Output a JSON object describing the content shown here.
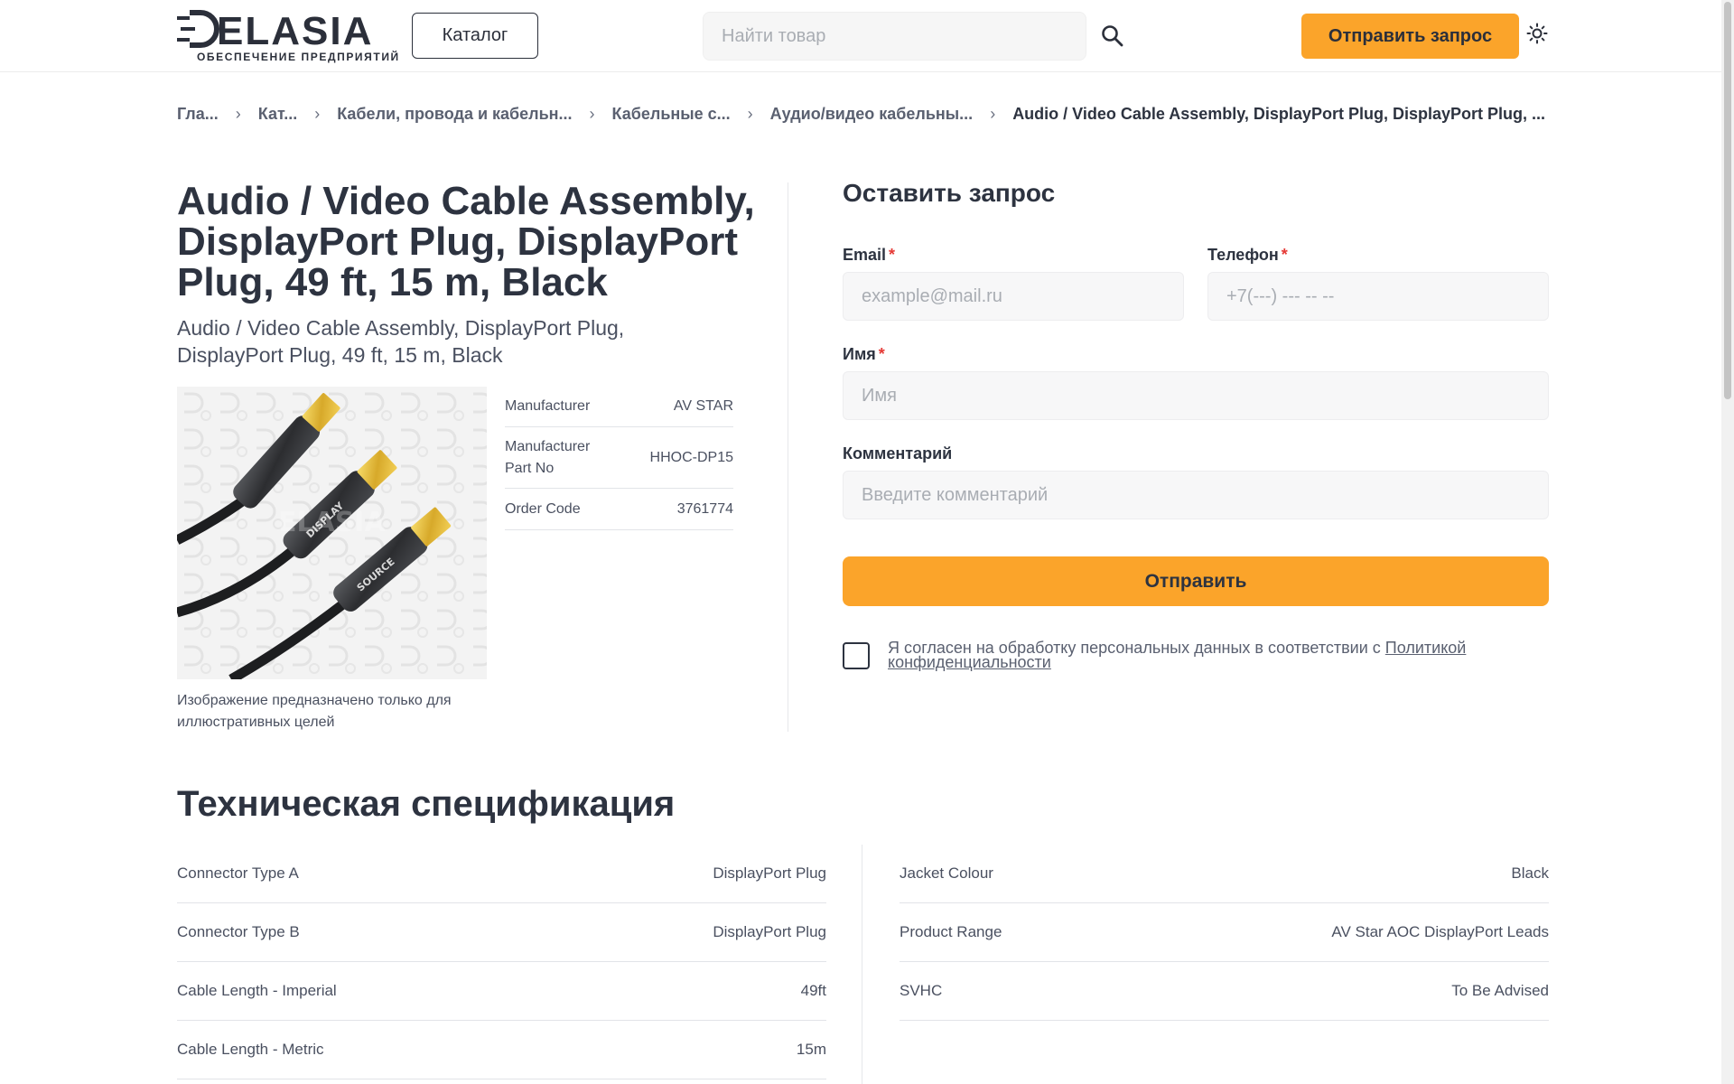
{
  "header": {
    "logo_name": "ELASIA",
    "logo_tagline": "ОБЕСПЕЧЕНИЕ ПРЕДПРИЯТИЙ",
    "catalog_label": "Каталог",
    "search_placeholder": "Найти товар",
    "request_label": "Отправить запрос",
    "search_icon": "search-icon",
    "theme_icon": "sun-icon"
  },
  "breadcrumb": [
    {
      "label": "Гла..."
    },
    {
      "label": "Кат..."
    },
    {
      "label": "Кабели, провода и кабельн..."
    },
    {
      "label": "Кабельные с..."
    },
    {
      "label": "Аудио/видео кабельны..."
    },
    {
      "label": "Audio / Video Cable Assembly, DisplayPort Plug, DisplayPort Plug, ..."
    }
  ],
  "product": {
    "title": "Audio / Video Cable Assembly, DisplayPort Plug, DisplayPort Plug, 49 ft, 15 m, Black",
    "subtitle": "Audio / Video Cable Assembly, DisplayPort Plug, DisplayPort Plug, 49 ft, 15 m, Black",
    "image_caption": "Изображение предназначено только для иллюстративных целей",
    "image_watermark": "ELASIA",
    "connector_labels": [
      "DISPLAY",
      "SOURCE"
    ],
    "key_specs": [
      {
        "label": "Manufacturer",
        "value": "AV STAR"
      },
      {
        "label": "Manufacturer Part No",
        "value": "HHOC-DP15"
      },
      {
        "label": "Order Code",
        "value": "3761774"
      }
    ]
  },
  "form": {
    "title": "Оставить запрос",
    "email_label": "Email",
    "email_placeholder": "example@mail.ru",
    "phone_label": "Телефон",
    "phone_placeholder": "+7(---) --- -- --",
    "name_label": "Имя",
    "name_placeholder": "Имя",
    "comment_label": "Комментарий",
    "comment_placeholder": "Введите комментарий",
    "required_mark": "*",
    "submit_label": "Отправить",
    "consent_text": "Я согласен на обработку персональных данных в соответствии с ",
    "consent_link": "Политикой конфиденциальности",
    "consent_checked": false
  },
  "tech_spec": {
    "title": "Техническая спецификация",
    "left": [
      {
        "label": "Connector Type A",
        "value": "DisplayPort Plug"
      },
      {
        "label": "Connector Type B",
        "value": "DisplayPort Plug"
      },
      {
        "label": "Cable Length - Imperial",
        "value": "49ft"
      },
      {
        "label": "Cable Length - Metric",
        "value": "15m"
      }
    ],
    "right": [
      {
        "label": "Jacket Colour",
        "value": "Black"
      },
      {
        "label": "Product Range",
        "value": "AV Star AOC DisplayPort Leads"
      },
      {
        "label": "SVHC",
        "value": "To Be Advised"
      }
    ]
  },
  "colors": {
    "accent": "#fba42a",
    "text": "#2d3340",
    "required": "#e53935"
  }
}
